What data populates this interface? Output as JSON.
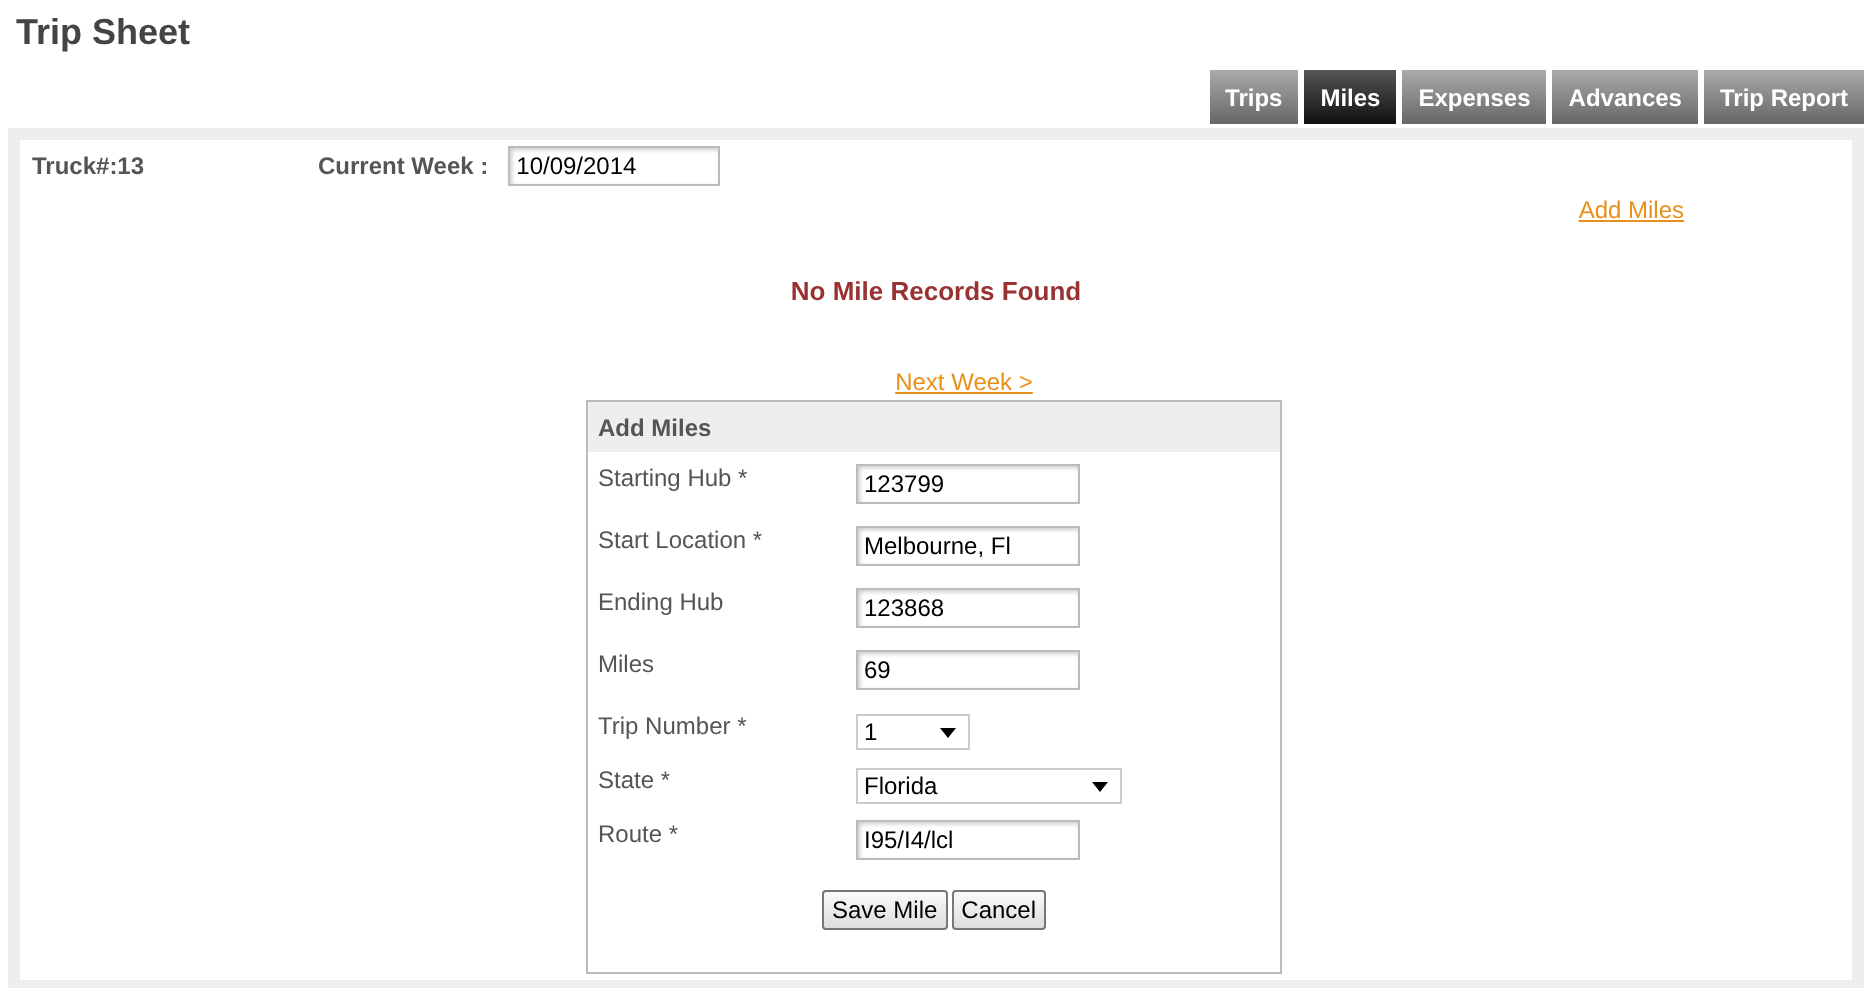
{
  "page": {
    "title": "Trip Sheet"
  },
  "tabs": [
    {
      "label": "Trips",
      "selected": false
    },
    {
      "label": "Miles",
      "selected": true
    },
    {
      "label": "Expenses",
      "selected": false
    },
    {
      "label": "Advances",
      "selected": false
    },
    {
      "label": "Trip Report",
      "selected": false
    }
  ],
  "header": {
    "truck": "Truck#:13",
    "week_label": "Current Week :",
    "week_value": "10/09/2014"
  },
  "add_link": "Add Miles",
  "message": "No Mile Records Found",
  "next_link": "Next Week >",
  "form": {
    "title": "Add Miles",
    "fields": [
      {
        "kind": "text",
        "label": "Starting Hub *",
        "value": "123799"
      },
      {
        "kind": "text",
        "label": "Start Location *",
        "value": "Melbourne, Fl"
      },
      {
        "kind": "text",
        "label": "Ending Hub",
        "value": "123868"
      },
      {
        "kind": "text",
        "label": "Miles",
        "value": "69"
      },
      {
        "kind": "select",
        "label": "Trip Number *",
        "value": "1"
      },
      {
        "kind": "wideselect",
        "label": "State *",
        "value": "Florida"
      },
      {
        "kind": "text",
        "label": "Route *",
        "value": "I95/I4/lcl"
      }
    ],
    "buttons": [
      "Save Mile",
      "Cancel"
    ]
  }
}
